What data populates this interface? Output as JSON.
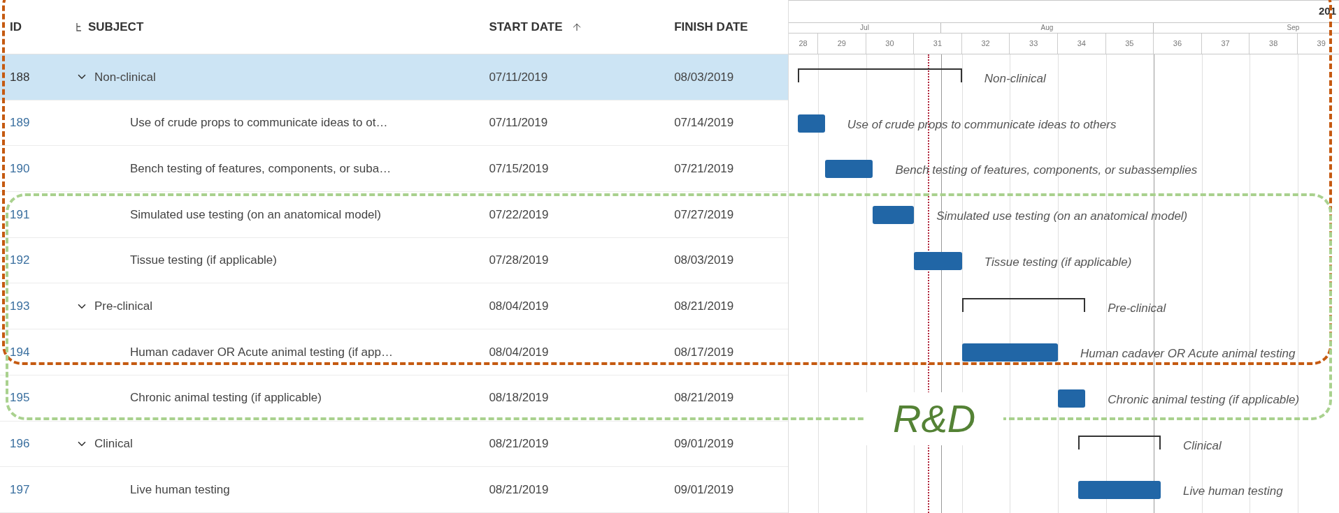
{
  "table": {
    "columns": [
      {
        "label": "ID"
      },
      {
        "label": "SUBJECT",
        "kind": "tree"
      },
      {
        "label": "START DATE",
        "sorted": true
      },
      {
        "label": "FINISH DATE"
      }
    ],
    "rows": [
      {
        "id": "188",
        "subject": "Non-clinical",
        "start": "07/11/2019",
        "finish": "08/03/2019",
        "kind": "summary",
        "expanded": true,
        "selected": true,
        "children": [
          {
            "id": "189",
            "subject": "Use of crude props to communicate ideas to ot…",
            "start": "07/11/2019",
            "finish": "07/14/2019",
            "kind": "task",
            "selected": false
          },
          {
            "id": "190",
            "subject": "Bench testing of features, components, or suba…",
            "start": "07/15/2019",
            "finish": "07/21/2019",
            "kind": "task",
            "selected": false
          },
          {
            "id": "191",
            "subject": "Simulated use testing (on an anatomical model)",
            "start": "07/22/2019",
            "finish": "07/27/2019",
            "kind": "task",
            "selected": false
          },
          {
            "id": "192",
            "subject": "Tissue testing (if applicable)",
            "start": "07/28/2019",
            "finish": "08/03/2019",
            "kind": "task",
            "selected": false
          }
        ]
      },
      {
        "id": "193",
        "subject": "Pre-clinical",
        "start": "08/04/2019",
        "finish": "08/21/2019",
        "kind": "summary",
        "expanded": true,
        "selected": false,
        "children": [
          {
            "id": "194",
            "subject": "Human cadaver OR Acute animal testing (if app…",
            "start": "08/04/2019",
            "finish": "08/17/2019",
            "kind": "task",
            "selected": false
          },
          {
            "id": "195",
            "subject": "Chronic animal testing (if applicable)",
            "start": "08/18/2019",
            "finish": "08/21/2019",
            "kind": "task",
            "selected": false
          }
        ]
      },
      {
        "id": "196",
        "subject": "Clinical",
        "start": "08/21/2019",
        "finish": "09/01/2019",
        "kind": "summary",
        "expanded": true,
        "selected": false,
        "children": [
          {
            "id": "197",
            "subject": "Live human testing",
            "start": "08/21/2019",
            "finish": "09/01/2019",
            "kind": "task",
            "selected": false
          }
        ]
      }
    ]
  },
  "gantt": {
    "year": "201",
    "months": [
      "Jul",
      "Aug",
      "Sep"
    ],
    "weeks": [
      "28",
      "29",
      "30",
      "31",
      "32",
      "33",
      "34",
      "35",
      "36",
      "37",
      "38",
      "39"
    ],
    "bar_labels": [
      "Non-clinical",
      "Use of crude props to communicate ideas to others",
      "Bench testing of features, components, or subassemplies",
      "Simulated use testing (on an anatomical model)",
      "Tissue testing (if applicable)",
      "Pre-clinical",
      "Human cadaver OR Acute animal testing",
      "Chronic animal testing (if applicable)",
      "Clinical",
      "Live human testing"
    ]
  },
  "annotations": [
    {
      "kind": "box",
      "color": "#c55a11"
    },
    {
      "kind": "box",
      "color": "#a9d18e",
      "label": "R&D"
    }
  ]
}
